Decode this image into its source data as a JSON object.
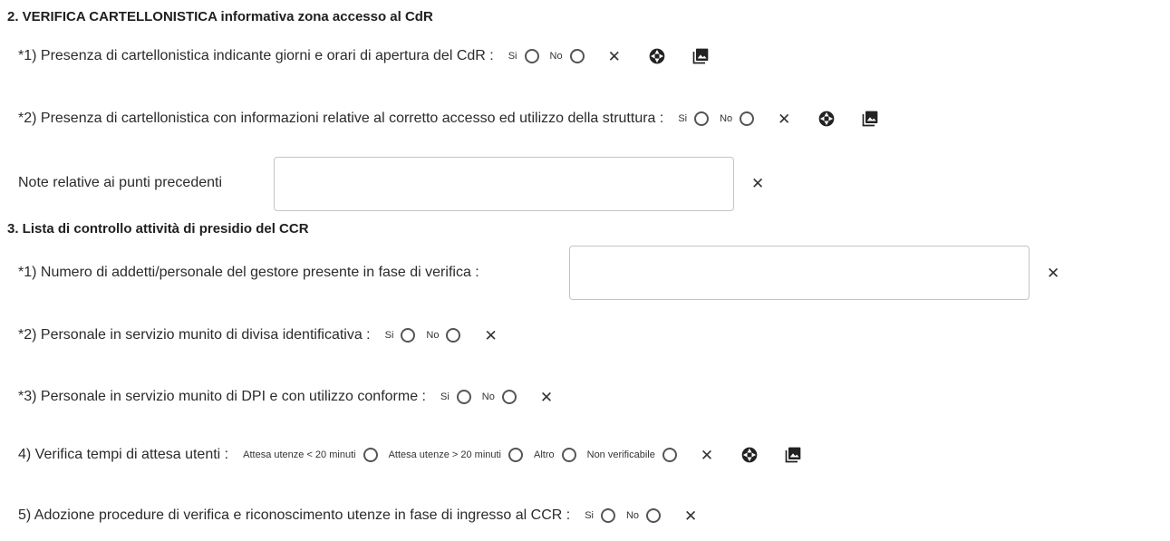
{
  "section2": {
    "title": "2. VERIFICA CARTELLONISTICA informativa zona accesso al CdR",
    "q1": {
      "label": "*1) Presenza di cartellonistica indicante giorni e orari di apertura del CdR :",
      "opt_yes": "Si",
      "opt_no": "No"
    },
    "q2": {
      "label": "*2) Presenza di cartellonistica con informazioni relative al corretto accesso ed utilizzo della struttura :",
      "opt_yes": "Si",
      "opt_no": "No"
    },
    "notes": {
      "label": "Note relative ai punti precedenti",
      "value": ""
    }
  },
  "section3": {
    "title": "3. Lista di controllo attività di presidio del CCR",
    "q1": {
      "label": "*1) Numero di addetti/personale del gestore presente in fase di verifica :",
      "value": ""
    },
    "q2": {
      "label": "*2) Personale in servizio munito di divisa identificativa :",
      "opt_yes": "Si",
      "opt_no": "No"
    },
    "q3": {
      "label": "*3) Personale in servizio munito di DPI e con utilizzo conforme :",
      "opt_yes": "Si",
      "opt_no": "No"
    },
    "q4": {
      "label": "4) Verifica tempi di attesa utenti :",
      "options": [
        "Attesa utenze < 20 minuti",
        "Attesa utenze > 20 minuti",
        "Altro",
        "Non verificabile"
      ]
    },
    "q5": {
      "label": "5) Adozione procedure di verifica e riconoscimento utenze in fase di ingresso al CCR :",
      "opt_yes": "Si",
      "opt_no": "No"
    }
  },
  "icons": {
    "clear": "close-icon",
    "camera": "camera-shutter-icon",
    "gallery": "photo-library-icon"
  },
  "clear_symbol": "✕"
}
